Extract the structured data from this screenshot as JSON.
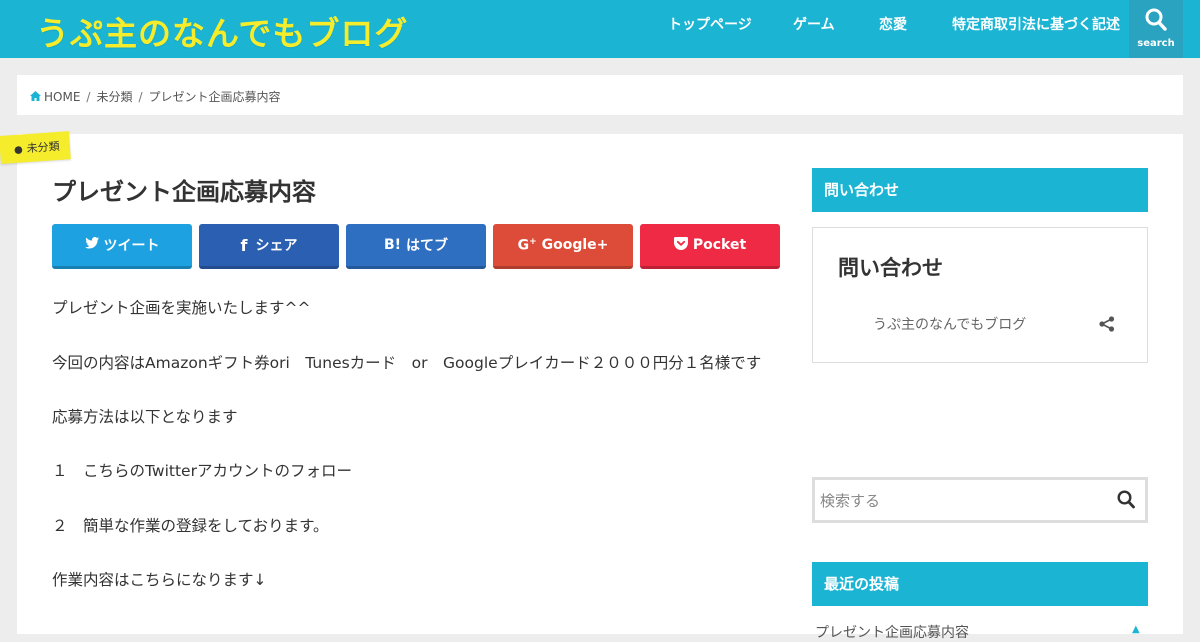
{
  "header": {
    "site_title": "うぷ主のなんでもブログ",
    "nav": [
      {
        "label": "トップページ"
      },
      {
        "label": "ゲーム"
      },
      {
        "label": "恋愛"
      },
      {
        "label": "特定商取引法に基づく記述"
      }
    ],
    "search_label": "search",
    "colors": {
      "bar": "#1bb4d3",
      "title": "#f5ed2b"
    }
  },
  "breadcrumb": {
    "home": "HOME",
    "category": "未分類",
    "current": "プレゼント企画応募内容",
    "separator": "/"
  },
  "post": {
    "category_badge": "未分類",
    "title": "プレゼント企画応募内容",
    "share_buttons": [
      {
        "label": "ツイート",
        "icon": "twitter-icon",
        "color": "#1da1e0"
      },
      {
        "label": "シェア",
        "icon": "facebook-icon",
        "color": "#2b5fb1"
      },
      {
        "label": "はてブ",
        "icon_text": "B!",
        "icon": "hatena-icon",
        "color": "#2f6fc2"
      },
      {
        "label": "Google+",
        "icon": "google-plus-icon",
        "color": "#dd4b39"
      },
      {
        "label": "Pocket",
        "icon": "pocket-icon",
        "color": "#ee2a44"
      }
    ],
    "paragraphs": [
      "プレゼント企画を実施いたします^^",
      "今回の内容はAmazonギフト券ori　Tunesカード　or　Googleプレイカード２０００円分１名様です",
      "応募方法は以下となります",
      "１　こちらのTwitterアカウントのフォロー",
      "２　簡単な作業の登録をしております。",
      "作業内容はこちらになります↓"
    ]
  },
  "sidebar": {
    "contact_head": "問い合わせ",
    "contact_card_title": "問い合わせ",
    "contact_card_blog": "うぷ主のなんでもブログ",
    "search_placeholder": "検索する",
    "recent_head": "最近の投稿",
    "recent_items": [
      "プレゼント企画応募内容"
    ]
  }
}
